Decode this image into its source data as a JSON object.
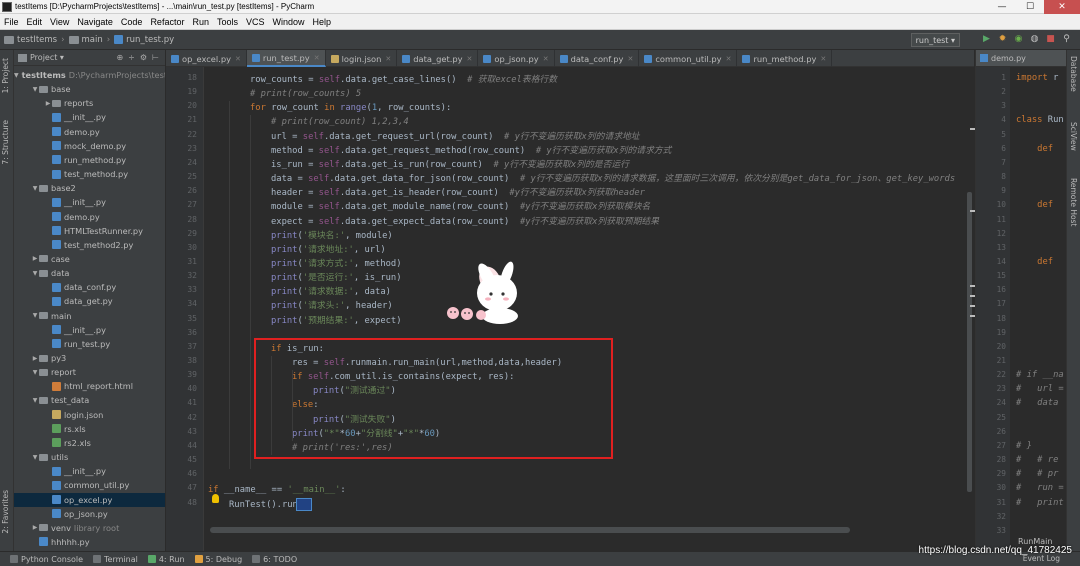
{
  "window": {
    "title": "testItems [D:\\PycharmProjects\\testItems] - ...\\main\\run_test.py [testItems] - PyCharm",
    "minimize": "—",
    "maximize": "☐",
    "close": "✕"
  },
  "menu": [
    "File",
    "Edit",
    "View",
    "Navigate",
    "Code",
    "Refactor",
    "Run",
    "Tools",
    "VCS",
    "Window",
    "Help"
  ],
  "breadcrumb": {
    "project": "testItems",
    "folder": "main",
    "file": "run_test.py"
  },
  "toolbar": {
    "run_config": "run_test ▾",
    "run": "▶",
    "debug": "✹",
    "coverage": "◉",
    "profile": "◍",
    "stop": "■",
    "search": "⚲"
  },
  "side_tabs": {
    "project": "1: Project",
    "structure": "7: Structure",
    "favorites": "2: Favorites",
    "database": "Database",
    "sciview": "SciView",
    "remote": "Remote Host"
  },
  "project_panel": {
    "title": "Project ▾",
    "header_icons": [
      "⊕",
      "÷",
      "⚙",
      "⊢"
    ],
    "tree": [
      {
        "label": "testItems",
        "extra": "D:\\PycharmProjects\\testItems",
        "type": "folder",
        "depth": 0,
        "open": true
      },
      {
        "label": "base",
        "type": "folder",
        "depth": 1,
        "open": true
      },
      {
        "label": "reports",
        "type": "folder",
        "depth": 2,
        "open": false
      },
      {
        "label": "__init__.py",
        "type": "py",
        "depth": 2
      },
      {
        "label": "demo.py",
        "type": "py",
        "depth": 2
      },
      {
        "label": "mock_demo.py",
        "type": "py",
        "depth": 2
      },
      {
        "label": "run_method.py",
        "type": "py",
        "depth": 2
      },
      {
        "label": "test_method.py",
        "type": "py",
        "depth": 2
      },
      {
        "label": "base2",
        "type": "folder",
        "depth": 1,
        "open": true
      },
      {
        "label": "__init__.py",
        "type": "py",
        "depth": 2
      },
      {
        "label": "demo.py",
        "type": "py",
        "depth": 2
      },
      {
        "label": "HTMLTestRunner.py",
        "type": "py",
        "depth": 2
      },
      {
        "label": "test_method2.py",
        "type": "py",
        "depth": 2
      },
      {
        "label": "case",
        "type": "folder",
        "depth": 1,
        "open": false
      },
      {
        "label": "data",
        "type": "folder",
        "depth": 1,
        "open": true
      },
      {
        "label": "data_conf.py",
        "type": "py",
        "depth": 2
      },
      {
        "label": "data_get.py",
        "type": "py",
        "depth": 2
      },
      {
        "label": "main",
        "type": "folder",
        "depth": 1,
        "open": true
      },
      {
        "label": "__init__.py",
        "type": "py",
        "depth": 2
      },
      {
        "label": "run_test.py",
        "type": "py",
        "depth": 2
      },
      {
        "label": "py3",
        "type": "folder",
        "depth": 1,
        "open": false
      },
      {
        "label": "report",
        "type": "folder",
        "depth": 1,
        "open": true
      },
      {
        "label": "html_report.html",
        "type": "html",
        "depth": 2
      },
      {
        "label": "test_data",
        "type": "folder",
        "depth": 1,
        "open": true
      },
      {
        "label": "login.json",
        "type": "json",
        "depth": 2
      },
      {
        "label": "rs.xls",
        "type": "xls",
        "depth": 2
      },
      {
        "label": "rs2.xls",
        "type": "xls",
        "depth": 2
      },
      {
        "label": "utils",
        "type": "folder",
        "depth": 1,
        "open": true
      },
      {
        "label": "__init__.py",
        "type": "py",
        "depth": 2
      },
      {
        "label": "common_util.py",
        "type": "py",
        "depth": 2
      },
      {
        "label": "op_excel.py",
        "type": "py",
        "depth": 2,
        "selected": true
      },
      {
        "label": "op_json.py",
        "type": "py",
        "depth": 2
      },
      {
        "label": "venv",
        "extra": "library root",
        "type": "folder",
        "depth": 1,
        "open": false
      },
      {
        "label": "hhhhh.py",
        "type": "py",
        "depth": 1
      }
    ]
  },
  "tabs": [
    {
      "label": "op_excel.py",
      "type": "py"
    },
    {
      "label": "run_test.py",
      "type": "py",
      "active": true
    },
    {
      "label": "login.json",
      "type": "json"
    },
    {
      "label": "data_get.py",
      "type": "py"
    },
    {
      "label": "op_json.py",
      "type": "py"
    },
    {
      "label": "data_conf.py",
      "type": "py"
    },
    {
      "label": "common_util.py",
      "type": "py"
    },
    {
      "label": "run_method.py",
      "type": "py"
    }
  ],
  "line_numbers": [
    "18",
    "19",
    "20",
    "21",
    "22",
    "23",
    "24",
    "25",
    "26",
    "27",
    "28",
    "29",
    "30",
    "31",
    "32",
    "33",
    "34",
    "35",
    "36",
    "37",
    "38",
    "39",
    "40",
    "41",
    "42",
    "43",
    "44",
    "45",
    "46",
    "47",
    "48"
  ],
  "code_lines": [
    {
      "n": "18",
      "i": 2,
      "t": [
        [
          "p",
          "row_counts = "
        ],
        [
          "s",
          "self"
        ],
        [
          "p",
          ".data.get_case_lines()  "
        ],
        [
          "c",
          "# 获取excel表格行数"
        ]
      ]
    },
    {
      "n": "19",
      "i": 2,
      "t": [
        [
          "c",
          "# print(row_counts) 5"
        ]
      ]
    },
    {
      "n": "20",
      "i": 2,
      "t": [
        [
          "k",
          "for "
        ],
        [
          "p",
          "row_count "
        ],
        [
          "k",
          "in "
        ],
        [
          "b",
          "range"
        ],
        [
          "p",
          "("
        ],
        [
          "n",
          "1"
        ],
        [
          "p",
          ", row_counts):"
        ]
      ]
    },
    {
      "n": "21",
      "i": 3,
      "t": [
        [
          "c",
          "# print(row_count) 1,2,3,4"
        ]
      ]
    },
    {
      "n": "22",
      "i": 3,
      "t": [
        [
          "p",
          "url = "
        ],
        [
          "s",
          "self"
        ],
        [
          "p",
          ".data.get_request_url(row_count)  "
        ],
        [
          "c",
          "# y行不变遍历获取x列的请求地址"
        ]
      ]
    },
    {
      "n": "23",
      "i": 3,
      "t": [
        [
          "p",
          "method = "
        ],
        [
          "s",
          "self"
        ],
        [
          "p",
          ".data.get_request_method(row_count)  "
        ],
        [
          "c",
          "# y行不变遍历获取x列的请求方式"
        ]
      ]
    },
    {
      "n": "24",
      "i": 3,
      "t": [
        [
          "p",
          "is_run = "
        ],
        [
          "s",
          "self"
        ],
        [
          "p",
          ".data.get_is_run(row_count)  "
        ],
        [
          "c",
          "# y行不变遍历获取x列的是否运行"
        ]
      ]
    },
    {
      "n": "25",
      "i": 3,
      "t": [
        [
          "p",
          "data = "
        ],
        [
          "s",
          "self"
        ],
        [
          "p",
          ".data.get_data_for_json(row_count)  "
        ],
        [
          "c",
          "# y行不变遍历获取x列的请求数据，这里面时三次调用，依次分别是get_data_for_json、get_key_words"
        ]
      ]
    },
    {
      "n": "26",
      "i": 3,
      "t": [
        [
          "p",
          "header = "
        ],
        [
          "s",
          "self"
        ],
        [
          "p",
          ".data.get_is_header(row_count)  "
        ],
        [
          "c",
          "#y行不变遍历获取x列获取header"
        ]
      ]
    },
    {
      "n": "27",
      "i": 3,
      "t": [
        [
          "p",
          "module = "
        ],
        [
          "s",
          "self"
        ],
        [
          "p",
          ".data.get_module_name(row_count)  "
        ],
        [
          "c",
          "#y行不变遍历获取x列获取模块名"
        ]
      ]
    },
    {
      "n": "28",
      "i": 3,
      "t": [
        [
          "p",
          "expect = "
        ],
        [
          "s",
          "self"
        ],
        [
          "p",
          ".data.get_expect_data(row_count)  "
        ],
        [
          "c",
          "#y行不变遍历获取x列获取预期结果"
        ]
      ]
    },
    {
      "n": "29",
      "i": 3,
      "t": [
        [
          "b",
          "print"
        ],
        [
          "p",
          "("
        ],
        [
          "g",
          "'模块名:'"
        ],
        [
          "p",
          ", module)"
        ]
      ]
    },
    {
      "n": "30",
      "i": 3,
      "t": [
        [
          "b",
          "print"
        ],
        [
          "p",
          "("
        ],
        [
          "g",
          "'请求地址:'"
        ],
        [
          "p",
          ", url)"
        ]
      ]
    },
    {
      "n": "31",
      "i": 3,
      "t": [
        [
          "b",
          "print"
        ],
        [
          "p",
          "("
        ],
        [
          "g",
          "'请求方式:'"
        ],
        [
          "p",
          ", method)"
        ]
      ]
    },
    {
      "n": "32",
      "i": 3,
      "t": [
        [
          "b",
          "print"
        ],
        [
          "p",
          "("
        ],
        [
          "g",
          "'是否运行:'"
        ],
        [
          "p",
          ", is_run)"
        ]
      ]
    },
    {
      "n": "33",
      "i": 3,
      "t": [
        [
          "b",
          "print"
        ],
        [
          "p",
          "("
        ],
        [
          "g",
          "'请求数据:'"
        ],
        [
          "p",
          ", data)"
        ]
      ]
    },
    {
      "n": "34",
      "i": 3,
      "t": [
        [
          "b",
          "print"
        ],
        [
          "p",
          "("
        ],
        [
          "g",
          "'请求头:'"
        ],
        [
          "p",
          ", header)"
        ]
      ]
    },
    {
      "n": "35",
      "i": 3,
      "t": [
        [
          "b",
          "print"
        ],
        [
          "p",
          "("
        ],
        [
          "g",
          "'预期结果:'"
        ],
        [
          "p",
          ", expect)"
        ]
      ]
    },
    {
      "n": "36",
      "i": 3,
      "t": []
    },
    {
      "n": "37",
      "i": 3,
      "t": [
        [
          "k",
          "if "
        ],
        [
          "p",
          "is_run:"
        ]
      ]
    },
    {
      "n": "38",
      "i": 4,
      "t": [
        [
          "p",
          "res = "
        ],
        [
          "s",
          "self"
        ],
        [
          "p",
          ".runmain.run_main(url,method,data,header)"
        ]
      ]
    },
    {
      "n": "39",
      "i": 4,
      "t": [
        [
          "k",
          "if "
        ],
        [
          "s",
          "self"
        ],
        [
          "p",
          ".com_util.is_contains(expect, res):"
        ]
      ]
    },
    {
      "n": "40",
      "i": 5,
      "t": [
        [
          "b",
          "print"
        ],
        [
          "p",
          "("
        ],
        [
          "g",
          "\"测试通过\""
        ],
        [
          "p",
          ")"
        ]
      ]
    },
    {
      "n": "41",
      "i": 4,
      "t": [
        [
          "k",
          "else"
        ],
        [
          "p",
          ":"
        ]
      ]
    },
    {
      "n": "42",
      "i": 5,
      "t": [
        [
          "b",
          "print"
        ],
        [
          "p",
          "("
        ],
        [
          "g",
          "\"测试失败\""
        ],
        [
          "p",
          ")"
        ]
      ]
    },
    {
      "n": "43",
      "i": 4,
      "t": [
        [
          "b",
          "print"
        ],
        [
          "p",
          "("
        ],
        [
          "g",
          "\"*\""
        ],
        [
          "p",
          "*"
        ],
        [
          "n",
          "60"
        ],
        [
          "p",
          "+"
        ],
        [
          "g",
          "\"分割线\""
        ],
        [
          "p",
          "+"
        ],
        [
          "g",
          "\"*\""
        ],
        [
          "p",
          "*"
        ],
        [
          "n",
          "60"
        ],
        [
          "p",
          ")"
        ]
      ]
    },
    {
      "n": "44",
      "i": 4,
      "t": [
        [
          "c",
          "# print('res:',res)"
        ]
      ]
    },
    {
      "n": "45",
      "i": 0,
      "t": []
    },
    {
      "n": "46",
      "i": 0,
      "t": []
    },
    {
      "n": "47",
      "i": 0,
      "t": [
        [
          "k",
          "if "
        ],
        [
          "p",
          "__name__ == "
        ],
        [
          "g",
          "'__main__'"
        ],
        [
          "p",
          ":"
        ]
      ]
    },
    {
      "n": "48",
      "i": 1,
      "t": [
        [
          "p",
          "RunTest().run()"
        ]
      ]
    }
  ],
  "right_editor": {
    "tab": "demo.py",
    "line_numbers": [
      "1",
      "2",
      "3",
      "4",
      "5",
      "6",
      "7",
      "8",
      "9",
      "10",
      "11",
      "12",
      "13",
      "14",
      "15",
      "16",
      "17",
      "18",
      "19",
      "20",
      "21",
      "22",
      "23",
      "24",
      "25",
      "26",
      "27",
      "28",
      "29",
      "30",
      "31",
      "32",
      "33"
    ],
    "code": [
      {
        "row": 0,
        "t": [
          [
            "k",
            "import "
          ],
          [
            "p",
            "r"
          ]
        ]
      },
      {
        "row": 3,
        "t": [
          [
            "k",
            "class "
          ],
          [
            "p",
            "Run"
          ]
        ]
      },
      {
        "row": 5,
        "t": [
          [
            "k",
            "    def "
          ]
        ]
      },
      {
        "row": 9,
        "t": [
          [
            "k",
            "    def "
          ]
        ]
      },
      {
        "row": 13,
        "t": [
          [
            "k",
            "    def "
          ]
        ]
      },
      {
        "row": 21,
        "t": [
          [
            "c",
            "# if __na"
          ]
        ]
      },
      {
        "row": 22,
        "t": [
          [
            "c",
            "#   url ="
          ]
        ]
      },
      {
        "row": 23,
        "t": [
          [
            "c",
            "#   data"
          ]
        ]
      },
      {
        "row": 26,
        "t": [
          [
            "c",
            "# }"
          ]
        ]
      },
      {
        "row": 27,
        "t": [
          [
            "c",
            "#   # re"
          ]
        ]
      },
      {
        "row": 28,
        "t": [
          [
            "c",
            "#   # pr"
          ]
        ]
      },
      {
        "row": 29,
        "t": [
          [
            "c",
            "#   run ="
          ]
        ]
      },
      {
        "row": 30,
        "t": [
          [
            "c",
            "#   print"
          ]
        ]
      }
    ],
    "footer": "RunMain"
  },
  "statusbar": {
    "python_console": "Python Console",
    "terminal": "Terminal",
    "run": "4: Run",
    "debug": "5: Debug",
    "todo": "6: TODO",
    "event_log": "Event Log"
  },
  "watermark": "https://blog.csdn.net/qq_41782425"
}
